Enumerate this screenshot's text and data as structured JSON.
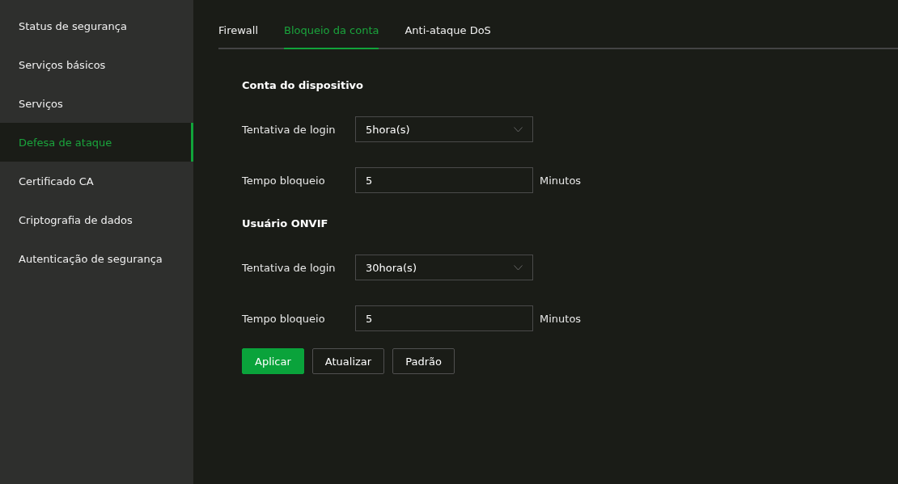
{
  "sidebar": {
    "items": [
      {
        "label": "Status de segurança",
        "selected": false
      },
      {
        "label": "Serviços básicos",
        "selected": false
      },
      {
        "label": "Serviços",
        "selected": false
      },
      {
        "label": "Defesa de ataque",
        "selected": true
      },
      {
        "label": "Certificado CA",
        "selected": false
      },
      {
        "label": "Criptografia de dados",
        "selected": false
      },
      {
        "label": "Autenticação de segurança",
        "selected": false
      }
    ]
  },
  "tabs": [
    {
      "label": "Firewall",
      "selected": false
    },
    {
      "label": "Bloqueio da conta",
      "selected": true
    },
    {
      "label": "Anti-ataque DoS",
      "selected": false
    }
  ],
  "sections": [
    {
      "title": "Conta do dispositivo",
      "fields": [
        {
          "kind": "select",
          "label": "Tentativa de login",
          "value": "5hora(s)"
        },
        {
          "kind": "text",
          "label": "Tempo bloqueio",
          "value": "5",
          "unit": "Minutos"
        }
      ]
    },
    {
      "title": "Usuário ONVIF",
      "fields": [
        {
          "kind": "select",
          "label": "Tentativa de login",
          "value": "30hora(s)"
        },
        {
          "kind": "text",
          "label": "Tempo bloqueio",
          "value": "5",
          "unit": "Minutos"
        }
      ]
    }
  ],
  "buttons": [
    {
      "label": "Aplicar",
      "kind": "primary"
    },
    {
      "label": "Atualizar",
      "kind": "default"
    },
    {
      "label": "Padrão",
      "kind": "default"
    }
  ]
}
